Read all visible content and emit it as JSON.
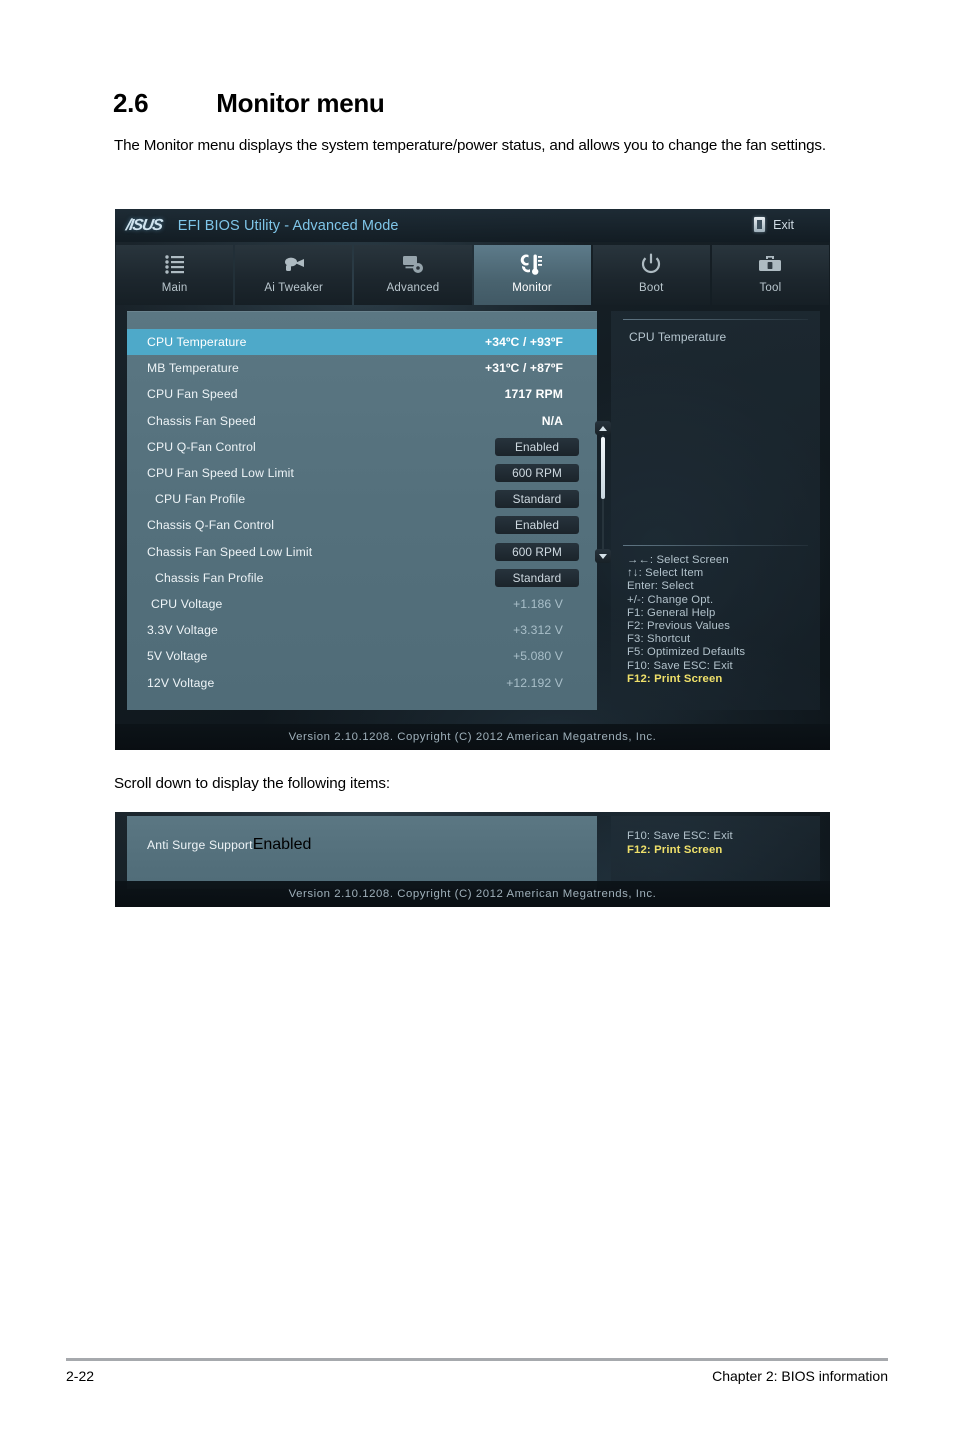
{
  "document": {
    "section_number": "2.6",
    "section_title": "Monitor menu",
    "intro": "The Monitor menu displays the system temperature/power status, and allows you to change the fan settings.",
    "scroll_note": "Scroll down to display the following items:",
    "footer_page": "2-22",
    "footer_chapter": "Chapter 2: BIOS information"
  },
  "bios": {
    "brand": "/ISUS",
    "title": "EFI BIOS Utility - Advanced Mode",
    "exit_label": "Exit",
    "exit_icon": "exit-door-icon",
    "version_text": "Version  2.10.1208.   Copyright  (C)  2012  American  Megatrends,  Inc.",
    "accent_selected": "#4ea9c9",
    "accent_panel": "#54707c",
    "accent_highlight": "#efe06a",
    "tabs": [
      {
        "label": "Main",
        "icon": "list-icon",
        "active": false
      },
      {
        "label": "Ai  Tweaker",
        "icon": "tweak-icon",
        "active": false
      },
      {
        "label": "Advanced",
        "icon": "monitor-gear-icon",
        "active": false
      },
      {
        "label": "Monitor",
        "icon": "thermometer-fan-icon",
        "active": true
      },
      {
        "label": "Boot",
        "icon": "power-icon",
        "active": false
      },
      {
        "label": "Tool",
        "icon": "toolbox-icon",
        "active": false
      }
    ],
    "items": [
      {
        "label": "CPU Temperature",
        "value": "+34ºC / +93ºF",
        "kind": "value",
        "selected": true,
        "indent": 0
      },
      {
        "label": "MB Temperature",
        "value": "+31ºC / +87ºF",
        "kind": "value",
        "selected": false,
        "indent": 0
      },
      {
        "label": "CPU Fan Speed",
        "value": "1717 RPM",
        "kind": "value",
        "selected": false,
        "indent": 0
      },
      {
        "label": "Chassis Fan Speed",
        "value": "N/A",
        "kind": "value",
        "selected": false,
        "indent": 0
      },
      {
        "label": "CPU Q-Fan Control",
        "value": "Enabled",
        "kind": "option",
        "selected": false,
        "indent": 0
      },
      {
        "label": "CPU Fan Speed Low Limit",
        "value": "600 RPM",
        "kind": "option",
        "selected": false,
        "indent": 0
      },
      {
        "label": "CPU Fan Profile",
        "value": "Standard",
        "kind": "option",
        "selected": false,
        "indent": 1
      },
      {
        "label": "Chassis Q-Fan Control",
        "value": "Enabled",
        "kind": "option",
        "selected": false,
        "indent": 0
      },
      {
        "label": "Chassis Fan Speed Low Limit",
        "value": "600 RPM",
        "kind": "option",
        "selected": false,
        "indent": 0
      },
      {
        "label": "Chassis Fan Profile",
        "value": "Standard",
        "kind": "option",
        "selected": false,
        "indent": 1
      },
      {
        "label": "CPU Voltage",
        "value": "+1.186 V",
        "kind": "dim",
        "selected": false,
        "indent": 2
      },
      {
        "label": "3.3V Voltage",
        "value": "+3.312 V",
        "kind": "dim",
        "selected": false,
        "indent": 0
      },
      {
        "label": "5V Voltage",
        "value": "+5.080 V",
        "kind": "dim",
        "selected": false,
        "indent": 0
      },
      {
        "label": "12V Voltage",
        "value": "+12.192 V",
        "kind": "dim",
        "selected": false,
        "indent": 0
      }
    ],
    "help": {
      "description": "CPU Temperature",
      "legend": [
        {
          "text": "→←:  Select Screen",
          "highlight": false
        },
        {
          "text": "↑↓:  Select Item",
          "highlight": false
        },
        {
          "text": "Enter:  Select",
          "highlight": false
        },
        {
          "text": "+/-:  Change Opt.",
          "highlight": false
        },
        {
          "text": "F1:  General Help",
          "highlight": false
        },
        {
          "text": "F2:  Previous Values",
          "highlight": false
        },
        {
          "text": "F3:  Shortcut",
          "highlight": false
        },
        {
          "text": "F5:  Optimized Defaults",
          "highlight": false
        },
        {
          "text": "F10:  Save   ESC:  Exit",
          "highlight": false
        },
        {
          "text": "F12: Print Screen",
          "highlight": true
        }
      ]
    },
    "scrollbar": {
      "up_arrow": "scroll-up-icon",
      "down_arrow": "scroll-down-icon"
    }
  },
  "bios_sub": {
    "item": {
      "label": "Anti Surge Support",
      "value": "Enabled"
    },
    "legend": [
      {
        "text": "F10:  Save   ESC:  Exit",
        "highlight": false
      },
      {
        "text": "F12: Print Screen",
        "highlight": true
      }
    ],
    "version_text": "Version  2.10.1208.   Copyright  (C)  2012  American  Megatrends,  Inc."
  }
}
